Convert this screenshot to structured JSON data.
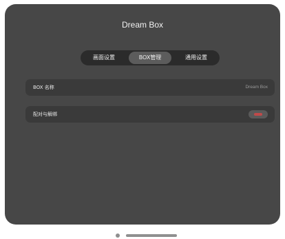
{
  "app": {
    "title": "Dream Box"
  },
  "tabs": [
    {
      "label": "画面设置",
      "active": false
    },
    {
      "label": "BOX管理",
      "active": true
    },
    {
      "label": "通用设置",
      "active": false
    }
  ],
  "settings": {
    "box_name": {
      "label": "BOX 名称",
      "value": "Dream Box"
    },
    "pairing": {
      "label": "配对与解绑",
      "toggle_state": "off"
    }
  },
  "colors": {
    "panel_background": "#474747",
    "row_background": "#3a3a3a",
    "tab_bar_background": "#2b2b2b",
    "active_tab_background": "#5c5c5c",
    "toggle_accent": "#c04a4a"
  }
}
